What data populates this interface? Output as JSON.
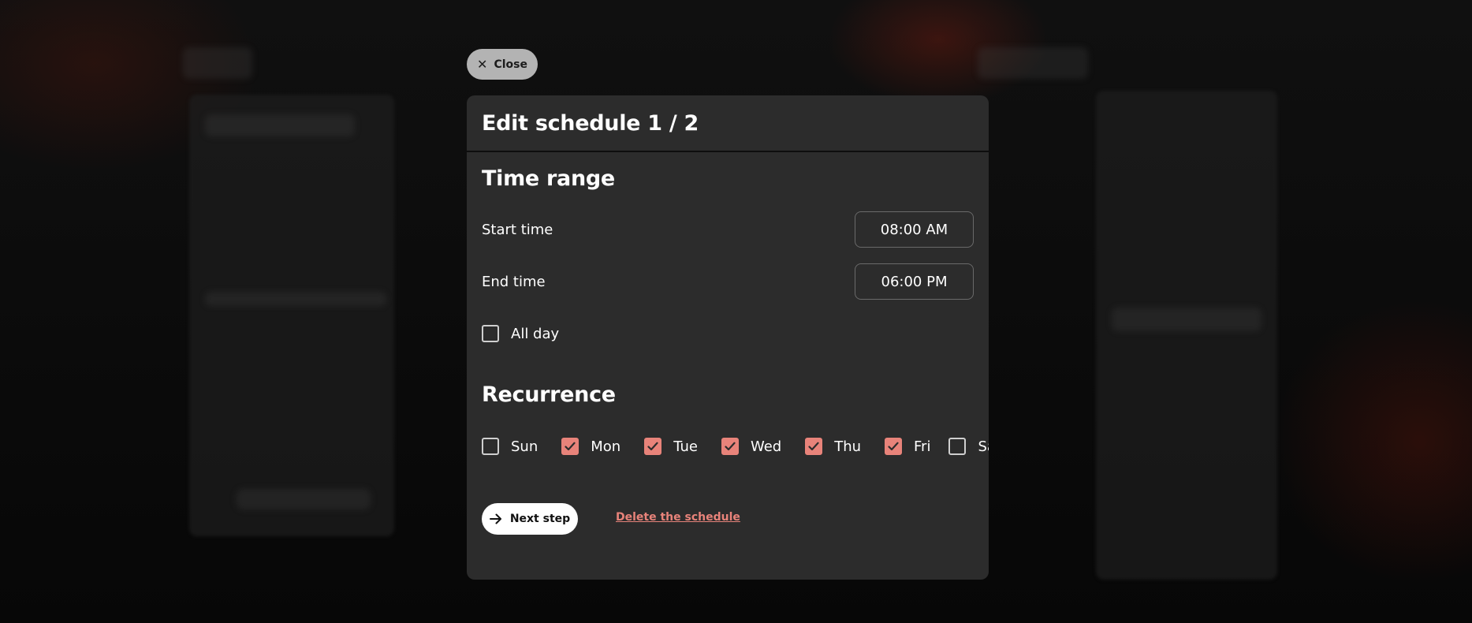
{
  "close_button": {
    "label": "Close",
    "icon": "close-icon"
  },
  "modal": {
    "title": "Edit schedule 1 / 2",
    "time_range": {
      "title": "Time range",
      "start_label": "Start time",
      "start_value": "08:00 AM",
      "end_label": "End time",
      "end_value": "06:00 PM",
      "all_day_label": "All day",
      "all_day_checked": false
    },
    "recurrence": {
      "title": "Recurrence",
      "days": [
        {
          "label": "Sun",
          "checked": false
        },
        {
          "label": "Mon",
          "checked": true
        },
        {
          "label": "Tue",
          "checked": true
        },
        {
          "label": "Wed",
          "checked": true
        },
        {
          "label": "Thu",
          "checked": true
        },
        {
          "label": "Fri",
          "checked": true
        },
        {
          "label": "Sat",
          "checked": false
        }
      ]
    },
    "actions": {
      "next_label": "Next step",
      "next_icon": "arrow-right-icon",
      "delete_label": "Delete the schedule"
    }
  },
  "colors": {
    "accent": "#e8837a",
    "modal_bg": "#2c2c2c",
    "close_bg": "#b3b3b3"
  }
}
